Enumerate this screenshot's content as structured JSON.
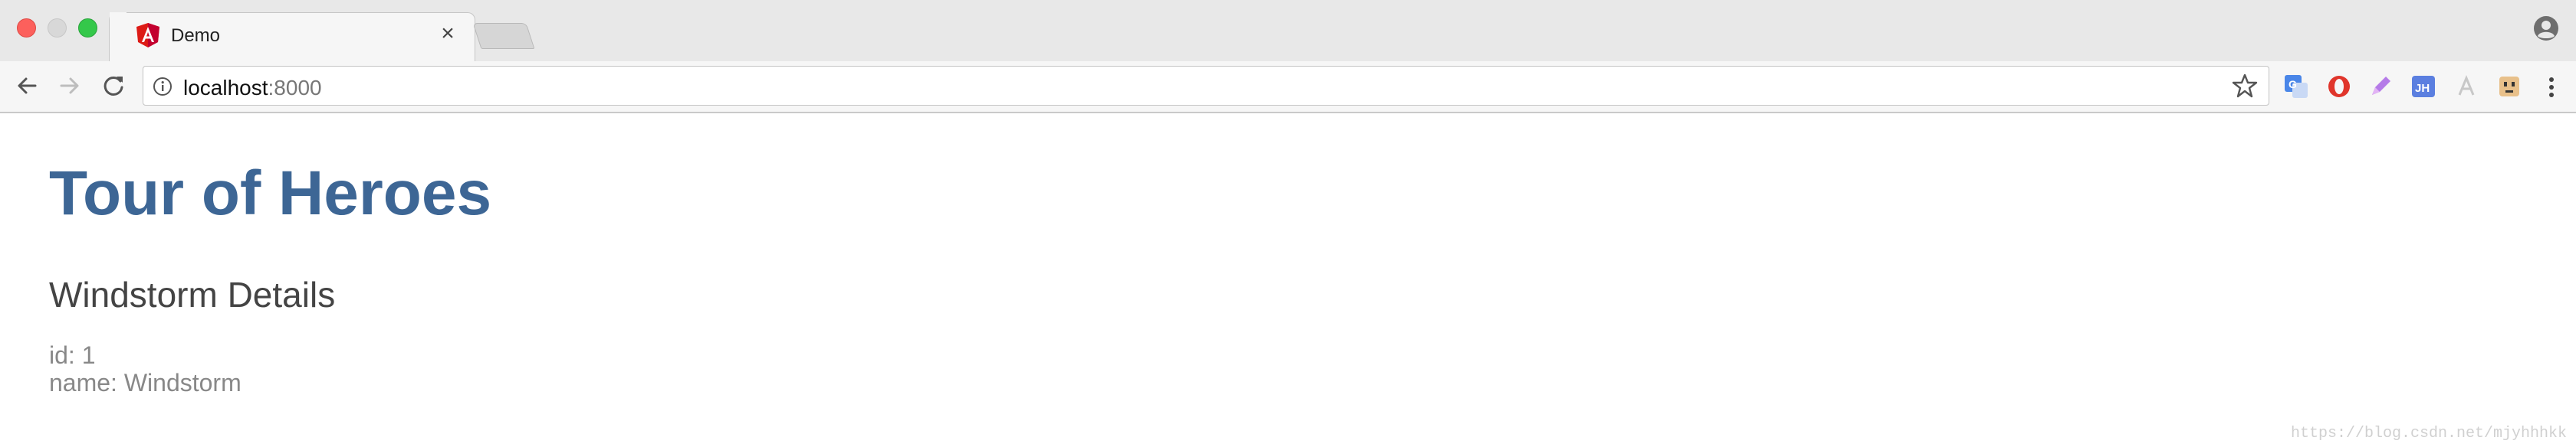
{
  "browser": {
    "tab": {
      "title": "Demo",
      "favicon": "angular-icon",
      "close_glyph": "×"
    },
    "address_bar": {
      "host": "localhost",
      "port": ":8000"
    },
    "extensions": [
      "translate-icon",
      "opera-icon",
      "pen-extension-icon",
      "jh-extension-icon",
      "font-extension-icon",
      "puzzle-face-icon"
    ],
    "colors": {
      "close": "#fc605c",
      "zoom": "#34c84a",
      "chrome": "#e8e8e8"
    }
  },
  "page": {
    "title": "Tour of Heroes",
    "detail_heading": "Windstorm Details",
    "id_row": "id: 1",
    "name_row": "name: Windstorm",
    "title_color": "#3d6695"
  },
  "watermark": "https://blog.csdn.net/mjyhhhkk"
}
